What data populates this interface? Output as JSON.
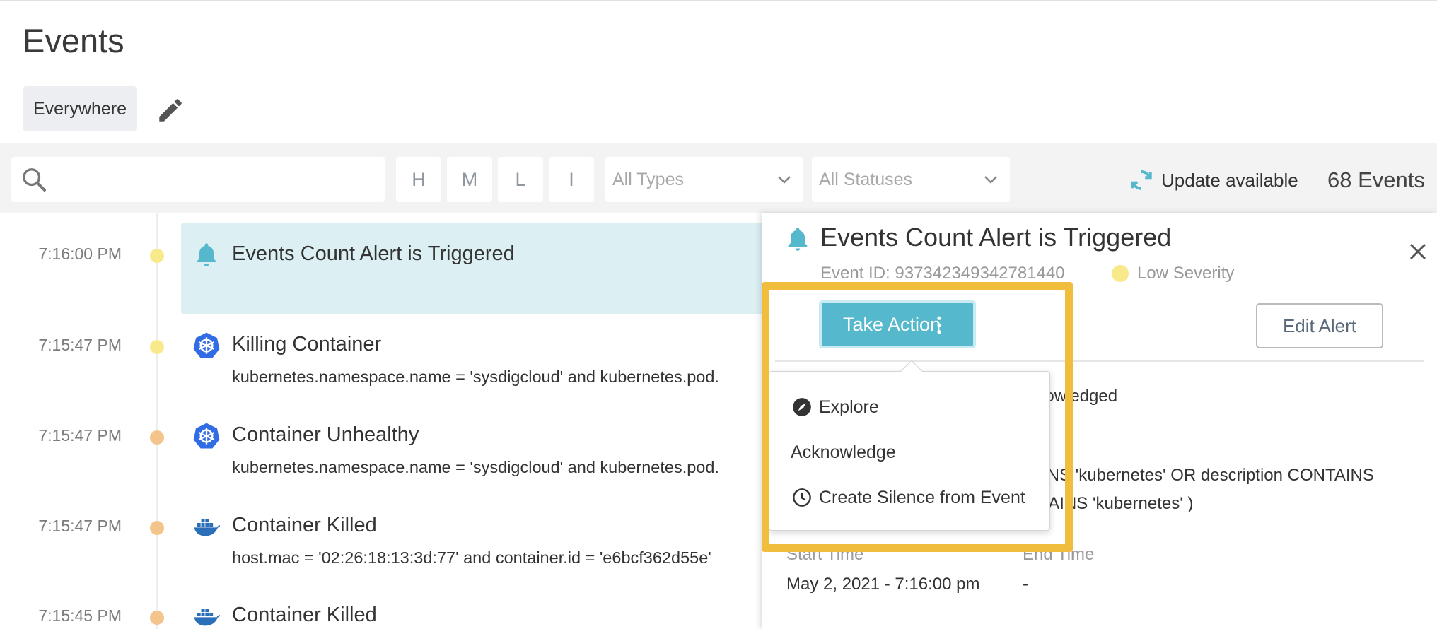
{
  "page": {
    "title": "Events"
  },
  "scope": {
    "label": "Everywhere"
  },
  "filters": {
    "search_placeholder": "",
    "severity_buttons": [
      "H",
      "M",
      "L",
      "I"
    ],
    "types": "All Types",
    "statuses": "All Statuses",
    "update_label": "Update available",
    "event_count": "68 Events"
  },
  "colors": {
    "accent": "#56b8cc",
    "highlight": "#f1bd3d",
    "low_severity_dot": "#f8e98b",
    "medium_severity_dot": "#f3c48b",
    "selected_row": "#dcf0f3"
  },
  "events": [
    {
      "time": "7:16:00 PM",
      "icon": "bell-icon",
      "title": "Events Count Alert is Triggered",
      "description": "",
      "severity": "low"
    },
    {
      "time": "7:15:47 PM",
      "icon": "kubernetes-icon",
      "title": "Killing Container",
      "description": "kubernetes.namespace.name = 'sysdigcloud' and kubernetes.pod.",
      "severity": "low"
    },
    {
      "time": "7:15:47 PM",
      "icon": "kubernetes-icon",
      "title": "Container Unhealthy",
      "description": "kubernetes.namespace.name = 'sysdigcloud' and kubernetes.pod.",
      "severity": "medium"
    },
    {
      "time": "7:15:47 PM",
      "icon": "docker-icon",
      "title": "Container Killed",
      "description": "host.mac = '02:26:18:13:3d:77' and container.id = 'e6bcf362d55e'",
      "severity": "medium"
    },
    {
      "time": "7:15:45 PM",
      "icon": "docker-icon",
      "title": "Container Killed",
      "description": "",
      "severity": "medium"
    }
  ],
  "detail": {
    "title": "Events Count Alert is Triggered",
    "event_id": "Event ID: 937342349342781440",
    "severity": "Low Severity",
    "take_action": "Take Action",
    "edit_alert": "Edit Alert",
    "status_fragment": "knowledged",
    "filter_line1": "AINS 'kubernetes' OR description CONTAINS",
    "filter_line2": "NTAINS 'kubernetes' )",
    "start_label": "Start Time",
    "end_label": "End Time",
    "start_value": "May 2, 2021 - 7:16:00 pm",
    "end_value": "-"
  },
  "action_menu": {
    "items": [
      {
        "label": "Explore",
        "icon": "compass-icon"
      },
      {
        "label": "Acknowledge",
        "icon": ""
      },
      {
        "label": "Create Silence from Event",
        "icon": "clock-icon"
      }
    ]
  }
}
